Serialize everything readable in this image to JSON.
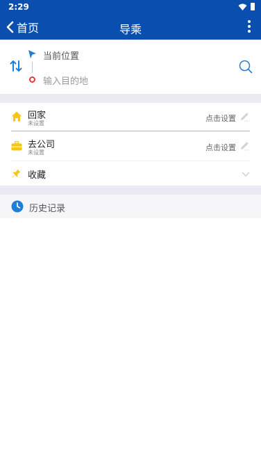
{
  "status_bar": {
    "time": "2:29"
  },
  "app_bar": {
    "back_label": "首页",
    "title": "导乘"
  },
  "route": {
    "current_location": "当前位置",
    "destination_placeholder": "输入目的地"
  },
  "favorites": {
    "home": {
      "label": "回家",
      "status": "未设置",
      "action": "点击设置"
    },
    "work": {
      "label": "去公司",
      "status": "未设置",
      "action": "点击设置"
    },
    "collection": {
      "label": "收藏"
    }
  },
  "history": {
    "label": "历史记录"
  },
  "colors": {
    "header": "#0a4fb0",
    "accent_blue": "#1f7fd6",
    "icon_yellow": "#f5c518",
    "destination_red": "#e53935",
    "section_gap": "#eceaf3"
  },
  "icons": [
    "back-arrow-icon",
    "more-vert-icon",
    "swap-icon",
    "location-arrow-icon",
    "destination-dot-icon",
    "search-icon",
    "home-icon",
    "briefcase-icon",
    "pin-icon",
    "pencil-icon",
    "chevron-down-icon",
    "clock-icon",
    "wifi-icon",
    "battery-icon"
  ]
}
